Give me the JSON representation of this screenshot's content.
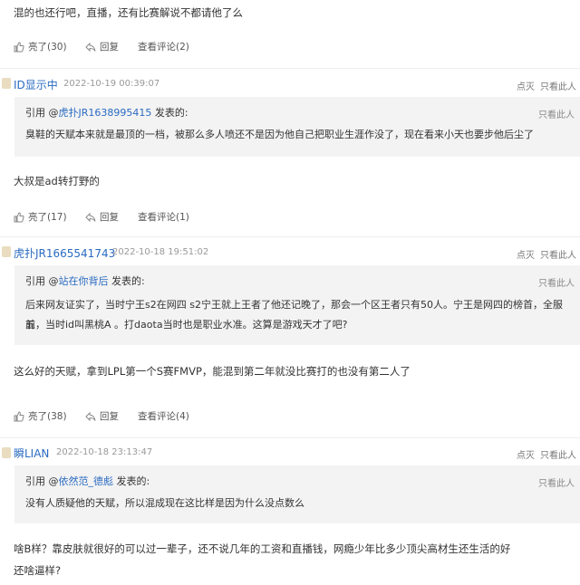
{
  "post0": {
    "text": "混的也还行吧，直播，还有比赛解说不都请他了么",
    "likes": "亮了(30)",
    "reply": "回复",
    "view": "查看评论(2)"
  },
  "post1": {
    "user": "ID显示中",
    "time": "2022-10-19 00:39:07",
    "dim": "点灭",
    "only": "只看此人",
    "quote": {
      "prefix": "引用 @",
      "user": "虎扑JR1638995415",
      "suffix": " 发表的:",
      "only": "只看此人",
      "body": "臭鞋的天赋本来就是最顶的一档，被那么多人喷还不是因为他自己把职业生涯作没了，现在看来小天也要步他后尘了"
    },
    "text": "大叔是ad转打野的",
    "likes": "亮了(17)",
    "reply": "回复",
    "view": "查看评论(1)"
  },
  "post2": {
    "user": "虎扑JR1665541743",
    "time": "2022-10-18 19:51:02",
    "dim": "点灭",
    "only": "只看此人",
    "quote": {
      "prefix": "引用 @",
      "user": "站在你背后",
      "suffix": " 发表的:",
      "only": "只看此人",
      "body_line1": "后来网友证实了，当时宁王s2在网四 s2宁王就上王者了他还记晚了，那会一个区王者只有50人。宁王是网四的榜首，全服前",
      "body_line2": "五，当时id叫黑桃A 。打daota当时也是职业水准。这算是游戏天才了吧?"
    },
    "text": "这么好的天赋，拿到LPL第一个S赛FMVP，能混到第二年就没比赛打的也没有第二人了",
    "likes": "亮了(38)",
    "reply": "回复",
    "view": "查看评论(4)"
  },
  "post3": {
    "user": "瞬LIAN",
    "time": "2022-10-18 23:13:47",
    "dim": "点灭",
    "only": "只看此人",
    "quote": {
      "prefix": "引用 @",
      "user": "依然范_德彪",
      "suffix": " 发表的:",
      "only": "只看此人",
      "body": "没有人质疑他的天赋，所以混成现在这比样是因为什么没点数么"
    },
    "text_line1": "啥B样？靠皮肤就很好的可以过一辈子，还不说几年的工资和直播钱，网瘾少年比多少顶尖高材生还生活的好",
    "text_line2": "还啥逼样?"
  },
  "icons": {
    "like": "thumbs-up-icon",
    "reply": "reply-arrow-icon",
    "avatar": "user-avatar"
  },
  "colors": {
    "username": "#2a6bc1",
    "quote_bg": "#f3f3f3",
    "meta": "#999999"
  }
}
